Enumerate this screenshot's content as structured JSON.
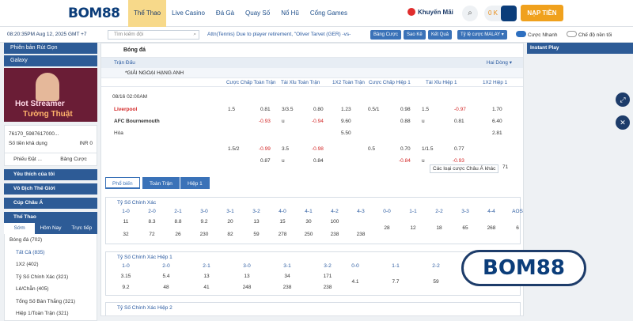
{
  "brand": {
    "logo": "BOM88",
    "accent": "#0b3d7a",
    "gold": "#f0a11d"
  },
  "nav": [
    "Thể Thao",
    "Live Casino",
    "Đá Gà",
    "Quay Số",
    "Nổ Hũ",
    "Cổng Games"
  ],
  "header": {
    "promo": "Khuyến Mãi",
    "balance": "0 K",
    "deposit": "NẠP TIỀN"
  },
  "subbar": {
    "clock": "08:20:35PM Aug 12, 2025 GMT +7",
    "search_placeholder": "Tìm kiếm đội",
    "ticker": "Attn(Tennis) Due to player retirement, \"Oliver Tarvet (GER) -vs-",
    "b1": "Bảng Cược",
    "b2": "Sao Kê",
    "b3": "Kết Quả",
    "b4": "Tỷ lệ cược MALAY ▾",
    "t1": "Cược Nhanh",
    "t2": "Chế độ nền tối"
  },
  "left": {
    "b1": "Phiên bản Rút Gọn",
    "b2": "Galaxy",
    "banner1": "Hot Streamer",
    "banner2": "Tường Thuật",
    "acct": "76170_5987617000...",
    "avail": "Số tiền khả dụng",
    "avail_val": "INR 0",
    "tab1": "Phiếu Đặt ...",
    "tab2": "Bảng Cược",
    "fav": "Yêu thích của tôi",
    "wc": "Vô Địch Thế Giới",
    "asia": "Cúp Châu Á",
    "sport": "Thể Thao",
    "st1": "Sớm",
    "st2": "Hôm Nay",
    "st3": "Trực tiếp",
    "football": "Bóng đá (702)",
    "items": [
      "Tất Cả (835)",
      "1X2 (402)",
      "Tỷ Số Chính Xác (321)",
      "Lẻ/Chẵn (405)",
      "Tổng Số Bàn Thắng (321)",
      "Hiệp 1/Toàn Trận (321)"
    ]
  },
  "center": {
    "title": "Bóng đá",
    "section": "Trận Đấu",
    "sort": "Hai Dòng ▾",
    "league": "*GIẢI NGOẠI HẠNG ANH",
    "cols": [
      "Cược Chấp Toàn Trận",
      "Tài Xỉu Toàn Trận",
      "1X2 Toàn Trận",
      "Cược Chấp Hiệp 1",
      "Tài Xỉu Hiệp 1",
      "1X2 Hiệp 1"
    ],
    "time": "08/16 02:00AM",
    "home": "Liverpool",
    "away": "AFC Bournemouth",
    "draw": "Hòa",
    "r1": [
      "1.5",
      "0.81",
      "3/3.5",
      "0.80",
      "1.23",
      "0.5/1",
      "0.98",
      "1.5",
      "-0.97",
      "1.70"
    ],
    "r2": [
      "-0.93",
      "u",
      "-0.94",
      "9.60",
      "0.88",
      "u",
      "0.81",
      "6.40"
    ],
    "r3": [
      "5.50",
      "2.81"
    ],
    "r4": [
      "1.5/2",
      "-0.99",
      "3.5",
      "-0.98",
      "0.5",
      "0.70",
      "1/1.5",
      "0.77"
    ],
    "r5": [
      "0.87",
      "u",
      "0.84",
      "-0.84",
      "u",
      "-0.93"
    ],
    "filter": "Các loại cược Châu Á khác",
    "filter_count": "71",
    "tabs": [
      "Phổ biến",
      "Toàn Trận",
      "Hiệp 1"
    ],
    "box1": "Tỷ Số Chính Xác",
    "box2": "Tỷ Số Chính Xác Hiệp 1",
    "box3": "Tỷ Số Chính Xác Hiệp 2",
    "g1h": [
      "1-0",
      "2-0",
      "2-1",
      "3-0",
      "3-1",
      "3-2",
      "4-0",
      "4-1",
      "4-2",
      "4-3",
      "0-0",
      "1-1",
      "2-2",
      "3-3",
      "4-4",
      "AOS"
    ],
    "g1a": [
      "11",
      "8.3",
      "8.8",
      "9.2",
      "20",
      "13",
      "15",
      "30",
      "100"
    ],
    "g1b": [
      "32",
      "72",
      "26",
      "230",
      "82",
      "59",
      "278",
      "250",
      "238",
      "238"
    ],
    "g1c": [
      "28",
      "12",
      "18",
      "65",
      "268",
      "6"
    ],
    "g2h": [
      "1-0",
      "2-0",
      "2-1",
      "3-0",
      "3-1",
      "3-2",
      "0-0",
      "1-1",
      "2-2",
      "3-3"
    ],
    "g2a": [
      "3.15",
      "5.4",
      "13",
      "13",
      "34",
      "171"
    ],
    "g2b": [
      "9.2",
      "48",
      "41",
      "248",
      "238",
      "238"
    ],
    "g2c": [
      "4.1",
      "7.7",
      "59",
      "300"
    ]
  },
  "right": {
    "instant": "Instant Play"
  },
  "watermark": "BOM88"
}
